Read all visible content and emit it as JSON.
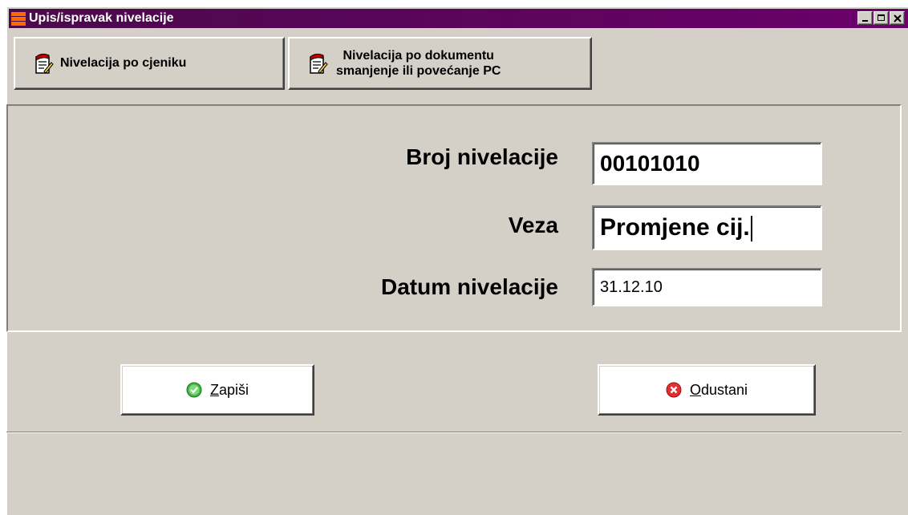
{
  "window": {
    "title": "Upis/ispravak nivelacije"
  },
  "toolbar": {
    "btn_price_list": "Nivelacija po cjeniku",
    "btn_document_line1": "Nivelacija po dokumentu",
    "btn_document_line2": "smanjenje ili povećanje PC"
  },
  "form": {
    "number_label": "Broj nivelacije",
    "number_value": "00101010",
    "link_label": "Veza",
    "link_value": "Promjene cij.",
    "date_label": "Datum nivelacije",
    "date_value": "31.12.10"
  },
  "actions": {
    "save_mnemonic": "Z",
    "save_rest": "apiši",
    "cancel_mnemonic": "O",
    "cancel_rest": "dustani"
  },
  "icons": {
    "app": "window-menu-icon",
    "toolbar": "document-edit-icon",
    "save": "checkmark-icon",
    "cancel": "close-circle-icon"
  },
  "colors": {
    "titlebar": "#6b006b",
    "save_icon": "#3cb43c",
    "cancel_icon": "#e03030"
  }
}
